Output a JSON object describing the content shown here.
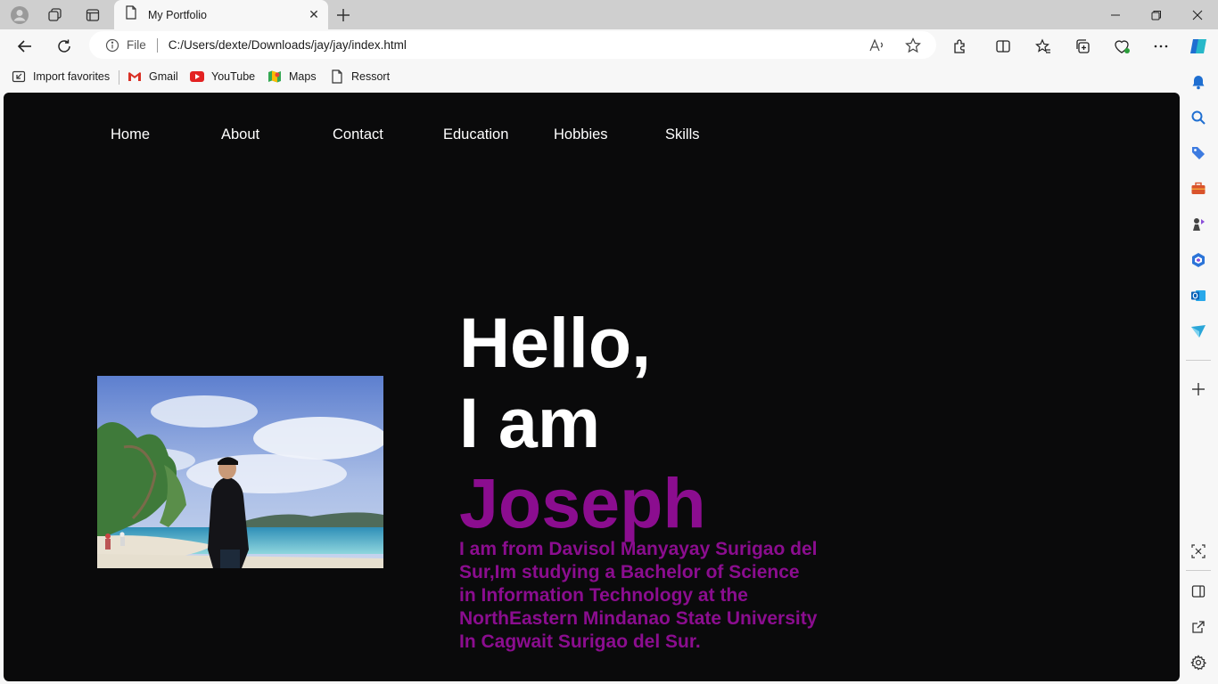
{
  "browser": {
    "tab": {
      "title": "My Portfolio"
    },
    "address": {
      "protocol_label": "File",
      "url": "C:/Users/dexte/Downloads/jay/jay/index.html"
    },
    "favorites": [
      {
        "label": "Import favorites",
        "icon": "import-icon"
      },
      {
        "label": "Gmail",
        "icon": "gmail-icon"
      },
      {
        "label": "YouTube",
        "icon": "youtube-icon"
      },
      {
        "label": "Maps",
        "icon": "maps-icon"
      },
      {
        "label": "Ressort",
        "icon": "page-icon"
      }
    ],
    "colors": {
      "accent": "#1f6fd1",
      "tabstrip": "#cfcfcf"
    }
  },
  "page": {
    "nav": [
      "Home",
      "About",
      "Contact",
      "Education",
      "Hobbies",
      "Skills"
    ],
    "hero": {
      "line1": "Hello,",
      "line2": "I am",
      "name": "Joseph",
      "bio": "I am from Davisol Manyayay Surigao del Sur,Im studying a Bachelor of Science in Information Technology at the NorthEastern Mindanao State University In Cagwait Surigao del Sur."
    },
    "colors": {
      "background": "#0a0a0b",
      "text": "#ffffff",
      "accent_purple": "#8b0d8f"
    }
  }
}
